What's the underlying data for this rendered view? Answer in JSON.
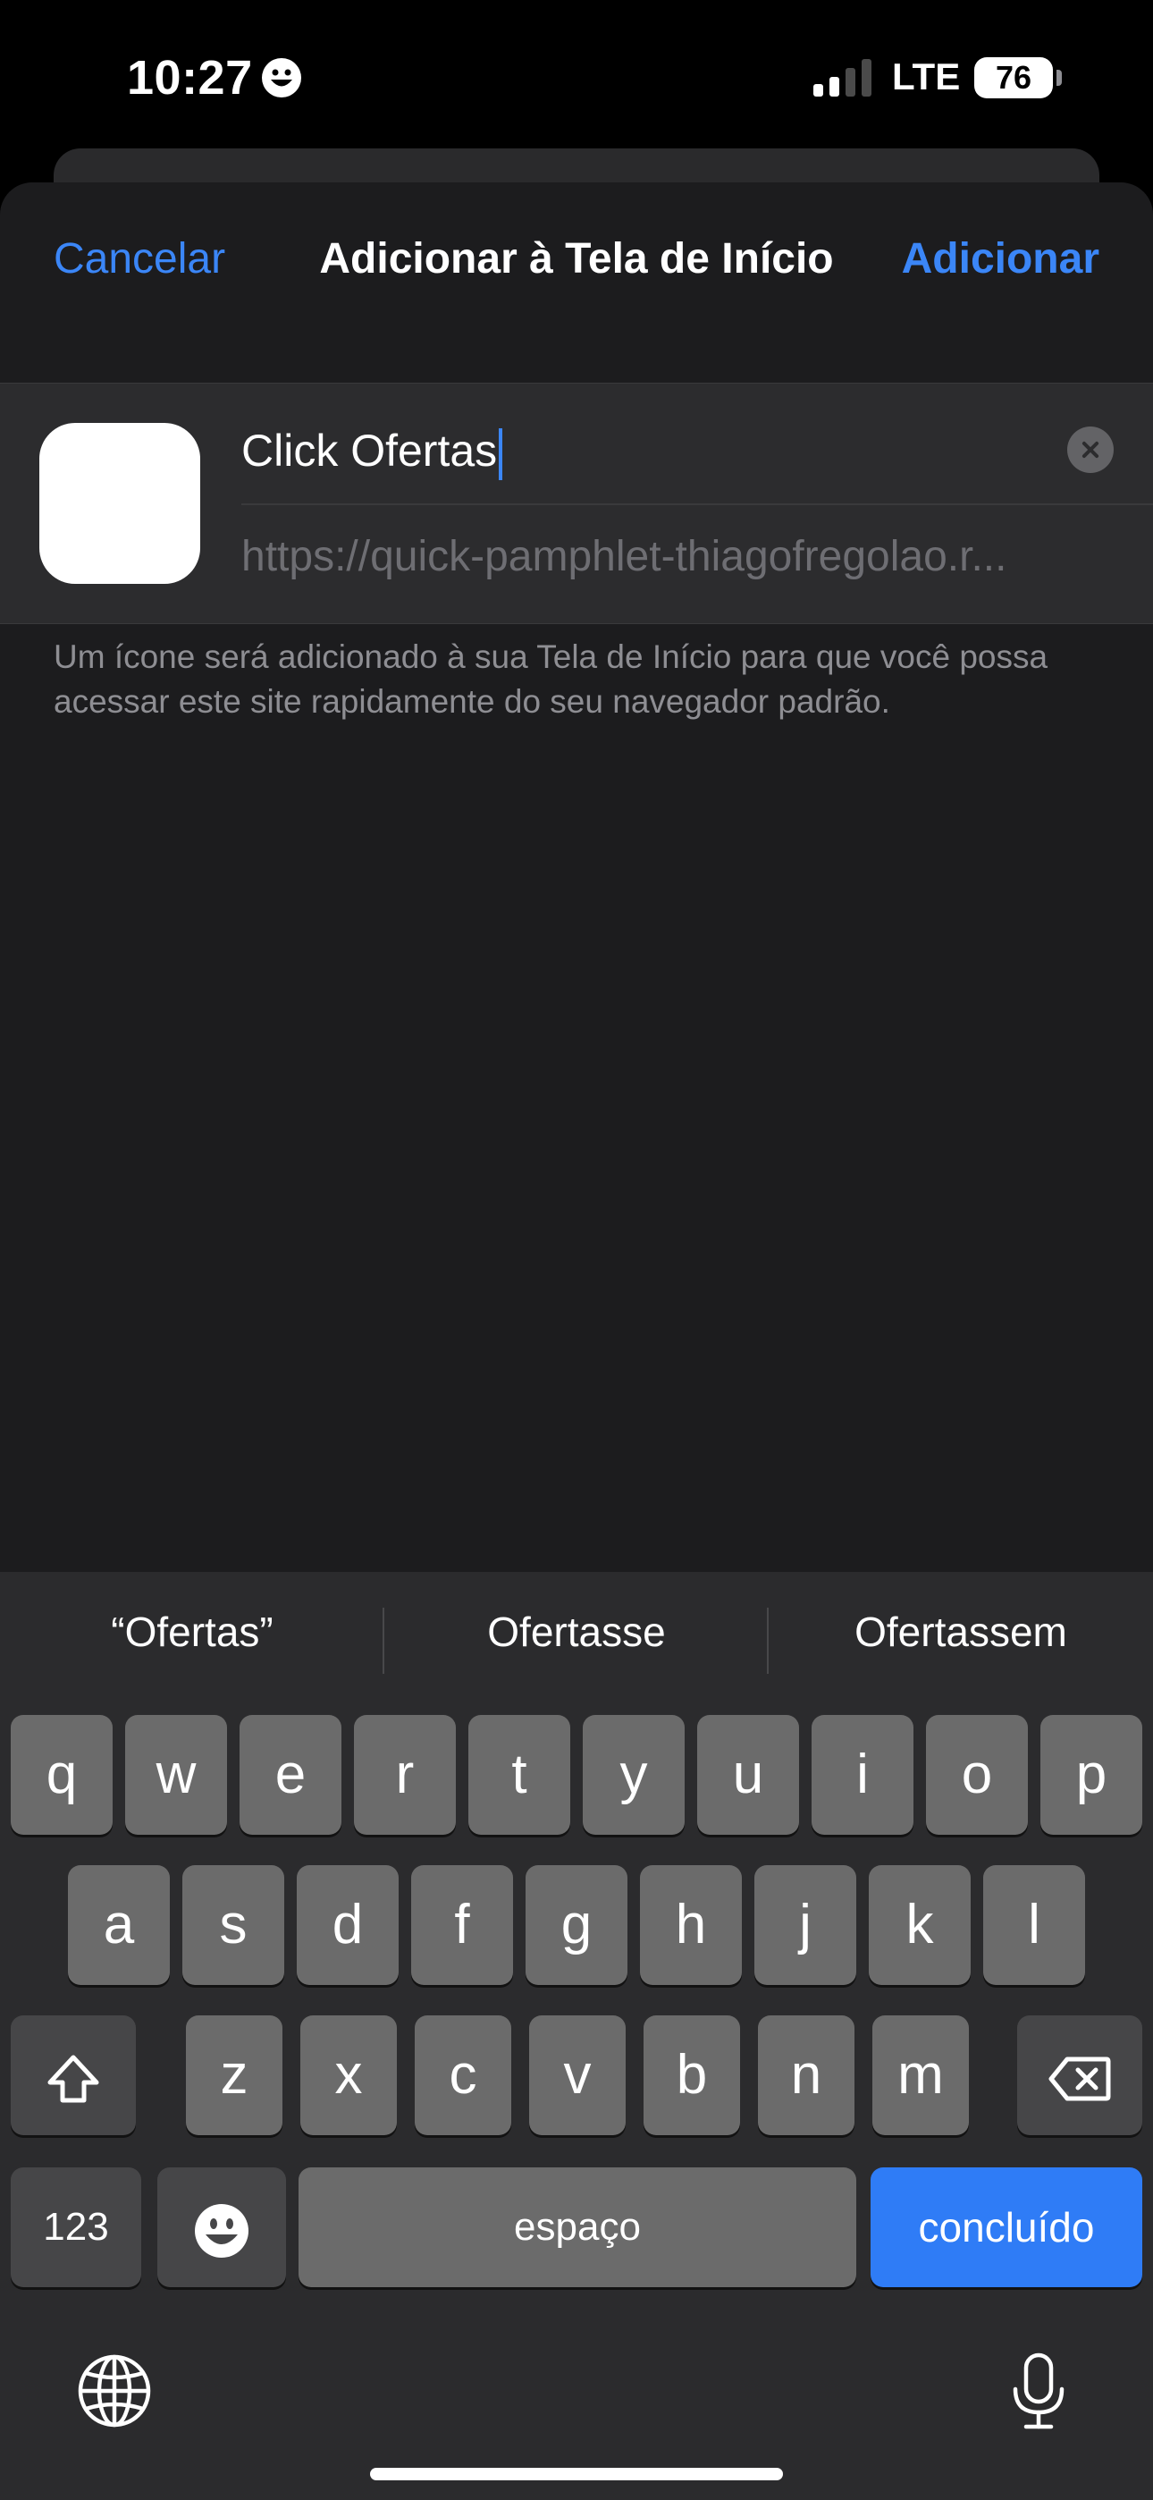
{
  "status_bar": {
    "time": "10:27",
    "network": "LTE",
    "battery": "76"
  },
  "nav": {
    "cancel_label": "Cancelar",
    "title": "Adicionar à Tela de Início",
    "add_label": "Adicionar"
  },
  "form": {
    "name_value": "Click Ofertas",
    "url_value": "https://quick-pamphlet-thiagofregolao.r..."
  },
  "description": "Um ícone será adicionado à sua Tela de Início para que você possa acessar este site rapidamente do seu navegador padrão.",
  "keyboard": {
    "suggestions": [
      "“Ofertas”",
      "Ofertasse",
      "Ofertassem"
    ],
    "row1": [
      "q",
      "w",
      "e",
      "r",
      "t",
      "y",
      "u",
      "i",
      "o",
      "p"
    ],
    "row2": [
      "a",
      "s",
      "d",
      "f",
      "g",
      "h",
      "j",
      "k",
      "l"
    ],
    "row3": [
      "z",
      "x",
      "c",
      "v",
      "b",
      "n",
      "m"
    ],
    "numbers_label": "123",
    "space_label": "espaço",
    "done_label": "concluído"
  },
  "colors": {
    "accent": "#3b86f7",
    "done_key": "#2f7cf6",
    "sheet_bg": "#1c1c1e",
    "keyboard_bg": "#2b2b2d"
  }
}
